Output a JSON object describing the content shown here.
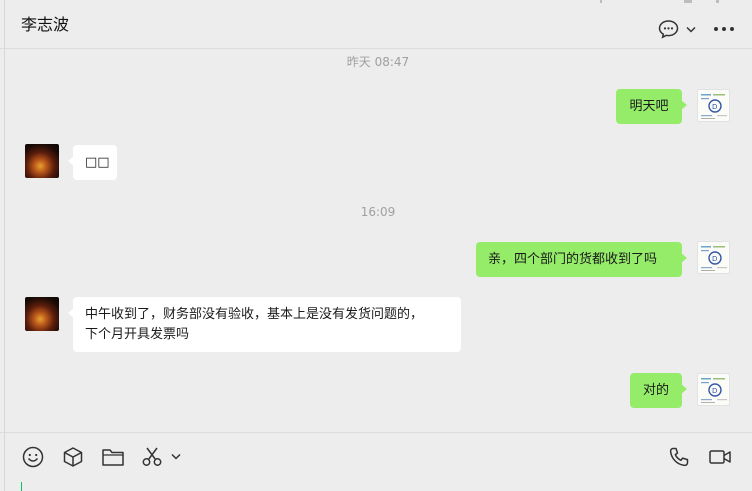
{
  "header": {
    "contact_name": "李志波",
    "icons": [
      "chat-bubble-icon",
      "chevron-down-icon",
      "more-icon"
    ]
  },
  "messages": [
    {
      "type": "time",
      "text": "昨天 08:47"
    },
    {
      "type": "msg",
      "sender": "me",
      "text": "明天吧"
    },
    {
      "type": "msg",
      "sender": "them",
      "text": "□□"
    },
    {
      "type": "time",
      "text": "16:09"
    },
    {
      "type": "msg",
      "sender": "me",
      "text": "亲，四个部门的货都收到了吗"
    },
    {
      "type": "msg",
      "sender": "them",
      "text": "中午收到了，财务部没有验收，基本上是没有发货问题的，\n下个月开具发票吗"
    },
    {
      "type": "msg",
      "sender": "me",
      "text": "对的"
    }
  ],
  "toolbar": {
    "icons": [
      "emoji-icon",
      "box-icon",
      "folder-icon",
      "scissors-icon",
      "chevron-down-icon",
      "phone-icon",
      "video-icon"
    ]
  },
  "colors": {
    "my_bubble": "#95ec69",
    "their_bubble": "#ffffff",
    "background": "#ededed",
    "cursor": "#07c160"
  }
}
